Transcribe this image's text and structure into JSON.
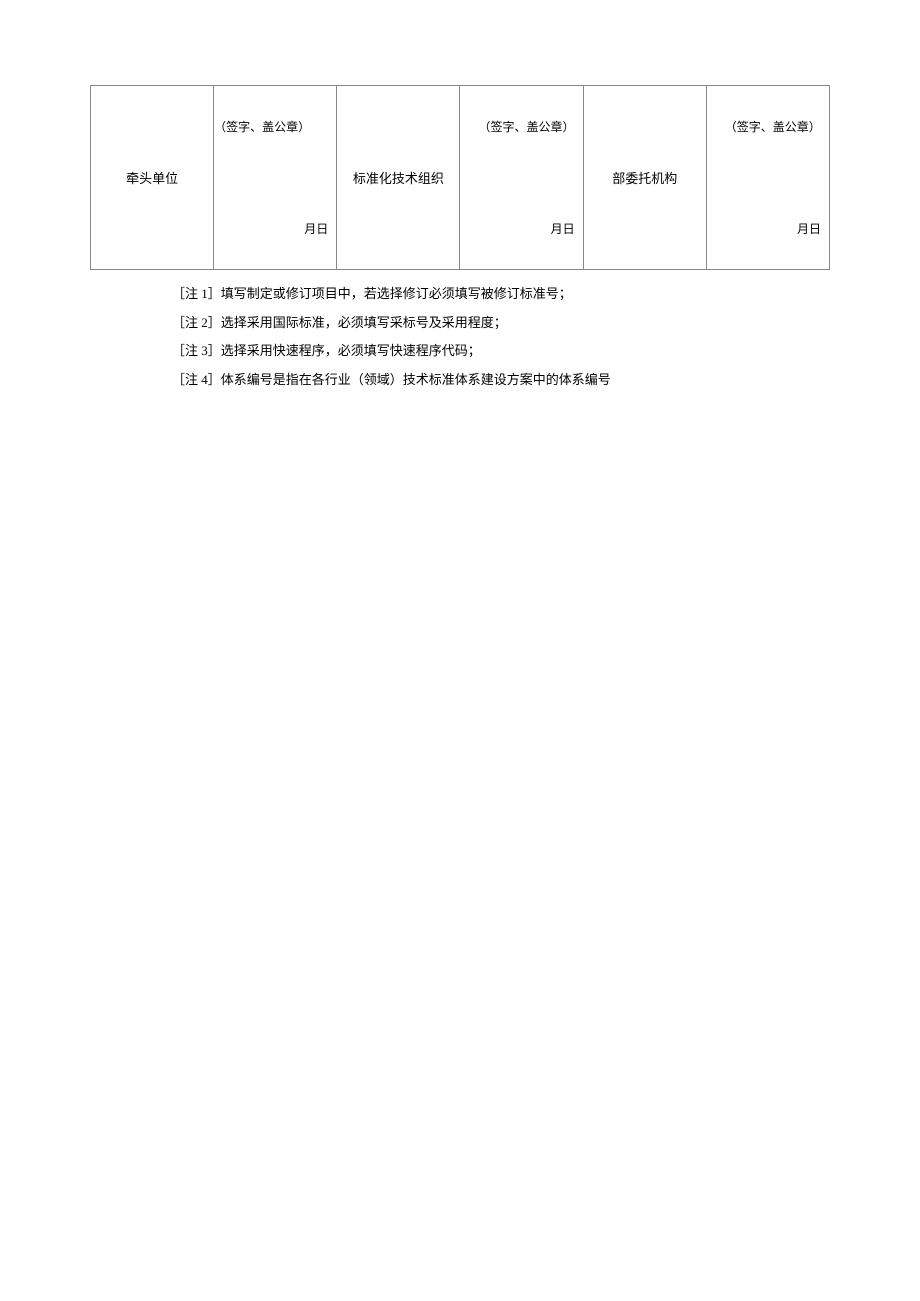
{
  "table": {
    "cells": [
      {
        "label": "牵头单位",
        "signature": "（签字、盖公章）",
        "date": "月日"
      },
      {
        "label": "标准化技术组织",
        "signature": "（签字、盖公章）",
        "date": "月日"
      },
      {
        "label": "部委托机构",
        "signature": "（签字、盖公章）",
        "date": "月日"
      }
    ]
  },
  "notes": [
    "［注 1］填写制定或修订项目中，若选择修订必须填写被修订标准号；",
    "［注 2］选择采用国际标准，必须填写采标号及采用程度；",
    "［注 3］选择采用快速程序，必须填写快速程序代码；",
    "［注 4］体系编号是指在各行业（领域）技术标准体系建设方案中的体系编号"
  ]
}
